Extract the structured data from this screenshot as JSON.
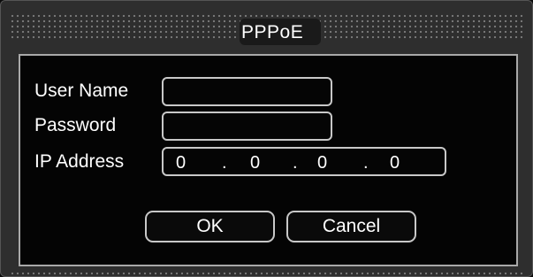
{
  "dialog": {
    "title": "PPPoE"
  },
  "form": {
    "user_name_label": "User Name",
    "user_name_value": "",
    "password_label": "Password",
    "password_value": "",
    "ip_label": "IP Address",
    "ip_octets": [
      "0",
      "0",
      "0",
      "0"
    ],
    "ip_separator": "."
  },
  "buttons": {
    "ok_label": "OK",
    "cancel_label": "Cancel"
  }
}
